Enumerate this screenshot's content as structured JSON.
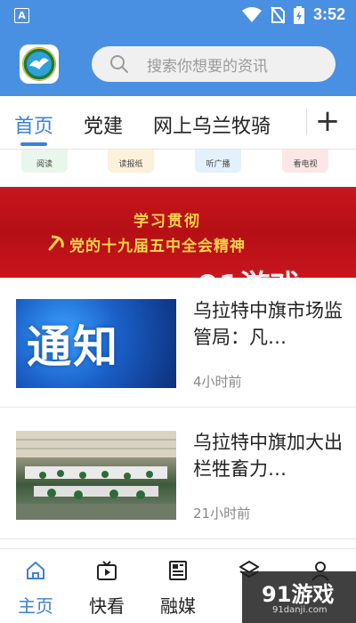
{
  "status_bar": {
    "time": "3:52",
    "notification_badge": "A"
  },
  "header": {
    "search_placeholder": "搜索你想要的资讯"
  },
  "tabs": [
    {
      "label": "首页",
      "active": true
    },
    {
      "label": "党建",
      "active": false
    },
    {
      "label": "网上乌兰牧骑",
      "active": false
    }
  ],
  "quick_icons": [
    {
      "label": "阅读",
      "color": "#3aa35a"
    },
    {
      "label": "读报纸",
      "color": "#e8a23b"
    },
    {
      "label": "听广播",
      "color": "#4a9be6"
    },
    {
      "label": "看电视",
      "color": "#e0414a"
    }
  ],
  "banner": {
    "line1": "学习贯彻",
    "line2": "党的十九届五中全会精神"
  },
  "watermark": {
    "brand": "91游戏",
    "site": "91danji.com"
  },
  "news": [
    {
      "thumb_text": "通知",
      "title": "乌拉特中旗市场监管局：凡…",
      "time": "4小时前"
    },
    {
      "title": "乌拉特中旗加大出栏牲畜力…",
      "time": "21小时前"
    }
  ],
  "bottom_nav": [
    {
      "label": "主页",
      "icon": "home-icon",
      "active": true
    },
    {
      "label": "快看",
      "icon": "video-icon",
      "active": false
    },
    {
      "label": "融媒",
      "icon": "newspaper-icon",
      "active": false
    },
    {
      "label": "",
      "icon": "layers-icon",
      "active": false
    },
    {
      "label": "",
      "icon": "person-icon",
      "active": false
    }
  ],
  "colors": {
    "primary": "#4a90e2",
    "tab_active": "#3b82d6",
    "banner_red": "#c8161d",
    "banner_text": "#ffd24a"
  }
}
